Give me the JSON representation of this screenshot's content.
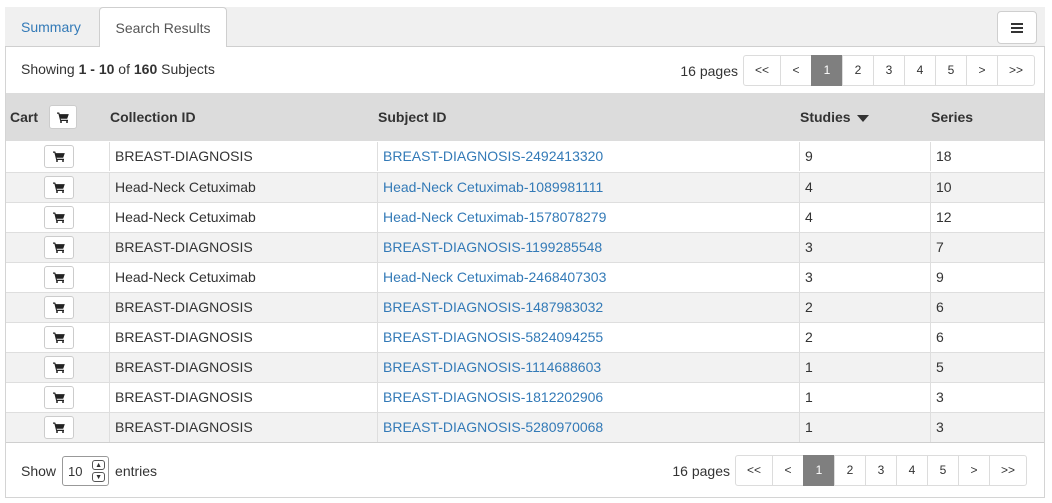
{
  "tabs": [
    {
      "label": "Summary"
    },
    {
      "label": "Search Results"
    }
  ],
  "summary": {
    "prefix": "Showing",
    "range": "1 - 10",
    "of": "of",
    "total": "160",
    "suffix": "Subjects"
  },
  "pager": {
    "pages_label": "16 pages",
    "first": "<<",
    "prev": "<",
    "pages": [
      "1",
      "2",
      "3",
      "4",
      "5"
    ],
    "active_page": "1",
    "next": ">",
    "last": ">>"
  },
  "table": {
    "headers": {
      "cart": "Cart",
      "collection": "Collection ID",
      "subject": "Subject ID",
      "studies": "Studies",
      "series": "Series"
    },
    "rows": [
      {
        "collection": "BREAST-DIAGNOSIS",
        "subject": "BREAST-DIAGNOSIS-2492413320",
        "studies": "9",
        "series": "18"
      },
      {
        "collection": "Head-Neck Cetuximab",
        "subject": "Head-Neck Cetuximab-1089981111",
        "studies": "4",
        "series": "10"
      },
      {
        "collection": "Head-Neck Cetuximab",
        "subject": "Head-Neck Cetuximab-1578078279",
        "studies": "4",
        "series": "12"
      },
      {
        "collection": "BREAST-DIAGNOSIS",
        "subject": "BREAST-DIAGNOSIS-1199285548",
        "studies": "3",
        "series": "7"
      },
      {
        "collection": "Head-Neck Cetuximab",
        "subject": "Head-Neck Cetuximab-2468407303",
        "studies": "3",
        "series": "9"
      },
      {
        "collection": "BREAST-DIAGNOSIS",
        "subject": "BREAST-DIAGNOSIS-1487983032",
        "studies": "2",
        "series": "6"
      },
      {
        "collection": "BREAST-DIAGNOSIS",
        "subject": "BREAST-DIAGNOSIS-5824094255",
        "studies": "2",
        "series": "6"
      },
      {
        "collection": "BREAST-DIAGNOSIS",
        "subject": "BREAST-DIAGNOSIS-1114688603",
        "studies": "1",
        "series": "5"
      },
      {
        "collection": "BREAST-DIAGNOSIS",
        "subject": "BREAST-DIAGNOSIS-1812202906",
        "studies": "1",
        "series": "3"
      },
      {
        "collection": "BREAST-DIAGNOSIS",
        "subject": "BREAST-DIAGNOSIS-5280970068",
        "studies": "1",
        "series": "3"
      }
    ]
  },
  "footer": {
    "show_label": "Show",
    "entries_value": "10",
    "entries_label": "entries"
  },
  "colors": {
    "link": "#337ab7",
    "active_page": "#7f7f7f",
    "header_bg": "#dcdcdc"
  },
  "icons": {
    "menu": "hamburger-menu-icon",
    "cart": "shopping-cart-icon",
    "sort": "sort-descending-icon"
  }
}
